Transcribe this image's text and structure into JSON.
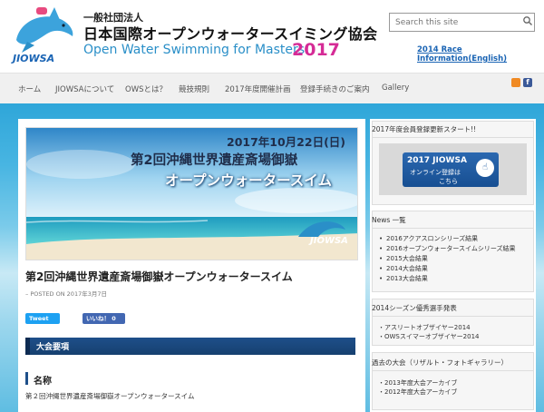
{
  "header": {
    "org_sub": "一般社団法人",
    "org_title": "日本国際オープンウォータースイミング協会",
    "org_eng": "Open Water Swimming for Masters",
    "org_year": "2017",
    "logo_text": "JIOWSA",
    "search_placeholder": "Search this site",
    "race_link": "2014 Race Information(English)"
  },
  "nav": {
    "items": [
      "ホーム",
      "JIOWSAについて",
      "OWSとは？",
      "競技規則",
      "2017年度開催計画",
      "登録手続きのご案内",
      "Gallery"
    ],
    "fb": "f"
  },
  "post": {
    "banner_date": "2017年10月22日(日)",
    "banner_line1": "第2回沖縄世界遺産斎場御嶽",
    "banner_line2": "オープンウォータースイム",
    "banner_logo": "JIOWSA",
    "title": "第2回沖縄世界遺産斎場御嶽オープンウォータースイム",
    "meta": "– POSTED ON 2017年3月7日",
    "tweet": "Tweet",
    "like": "いいね！ 0",
    "section": "大会要項",
    "sub_heading": "名称",
    "body": "第２回沖縄世界遺産斎場御嶽オープンウォータースイム"
  },
  "sidebar": {
    "reg_title": "2017年度会員登録更新スタート!!",
    "reg_line1": "2017 JIOWSA",
    "reg_line2": "オンライン登録は",
    "reg_line3": "こちら",
    "news_title": "News 一覧",
    "news_items": [
      "2016アクアスロンシリーズ結果",
      "2016オープンウォータースイムシリーズ結果",
      "2015大会結果",
      "2014大会結果",
      "2013大会結果"
    ],
    "award_title": "2014シーズン優秀選手発表",
    "award_items": [
      "・アスリートオブザイヤー2014",
      "・OWSスイマーオブザイヤー2014"
    ],
    "past_title": "過去の大会（リザルト・フォトギャラリー）",
    "past_items": [
      "・2013年度大会アーカイブ",
      "・2012年度大会アーカイブ"
    ]
  },
  "colors": {
    "accent_blue": "#1e4f8a",
    "link_blue": "#1a64b4",
    "eng_blue": "#2a8fc8",
    "year_pink": "#d52b96"
  }
}
